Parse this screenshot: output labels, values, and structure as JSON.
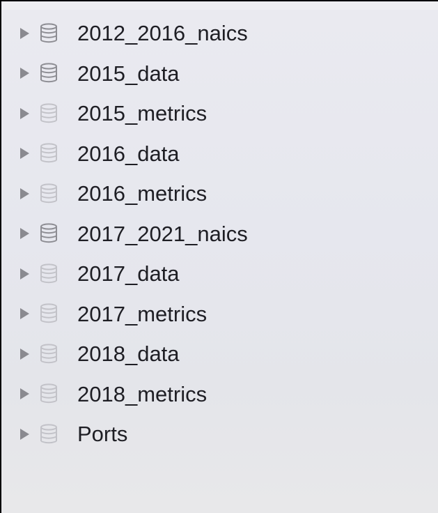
{
  "sidebar": {
    "items": [
      {
        "label": "2012_2016_naics",
        "icon": "database-icon",
        "state": "loaded"
      },
      {
        "label": "2015_data",
        "icon": "database-icon",
        "state": "loaded"
      },
      {
        "label": "2015_metrics",
        "icon": "database-icon",
        "state": "unloaded"
      },
      {
        "label": "2016_data",
        "icon": "database-icon",
        "state": "unloaded"
      },
      {
        "label": "2016_metrics",
        "icon": "database-icon",
        "state": "unloaded"
      },
      {
        "label": "2017_2021_naics",
        "icon": "database-icon",
        "state": "loaded"
      },
      {
        "label": "2017_data",
        "icon": "database-icon",
        "state": "unloaded"
      },
      {
        "label": "2017_metrics",
        "icon": "database-icon",
        "state": "unloaded"
      },
      {
        "label": "2018_data",
        "icon": "database-icon",
        "state": "unloaded"
      },
      {
        "label": "2018_metrics",
        "icon": "database-icon",
        "state": "unloaded"
      },
      {
        "label": "Ports",
        "icon": "database-icon",
        "state": "unloaded"
      }
    ]
  },
  "colors": {
    "background": "#e6e7ee",
    "text": "#1e1e24",
    "arrow": "#8a8a90",
    "icon_loaded": "#8d8d93",
    "icon_unloaded": "#c2c2c8"
  }
}
